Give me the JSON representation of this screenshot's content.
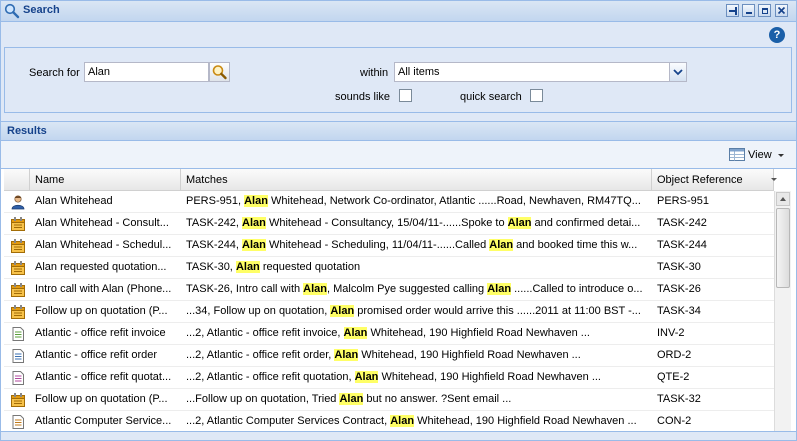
{
  "window": {
    "title": "Search"
  },
  "form": {
    "search_for_label": "Search for",
    "search_value": "Alan",
    "within_label": "within",
    "within_value": "All items",
    "sounds_like_label": "sounds like",
    "quick_search_label": "quick search"
  },
  "results": {
    "title": "Results",
    "view_label": "View",
    "columns": [
      "Name",
      "Matches",
      "Object Reference"
    ],
    "rows": [
      {
        "icon": "person-icon",
        "name": "Alan Whitehead",
        "matches": [
          [
            "PERS-951, ",
            0
          ],
          [
            "Alan",
            1
          ],
          [
            " Whitehead, Network Co-ordinator, Atlantic ......Road, Newhaven, RM47TQ...",
            0
          ]
        ],
        "ref": "PERS-951"
      },
      {
        "icon": "task-icon",
        "name": "Alan Whitehead - Consult...",
        "matches": [
          [
            "TASK-242, ",
            0
          ],
          [
            "Alan",
            1
          ],
          [
            " Whitehead - Consultancy, 15/04/11-......Spoke to ",
            0
          ],
          [
            "Alan",
            1
          ],
          [
            " and confirmed detai...",
            0
          ]
        ],
        "ref": "TASK-242"
      },
      {
        "icon": "task-icon",
        "name": "Alan Whitehead - Schedul...",
        "matches": [
          [
            "TASK-244, ",
            0
          ],
          [
            "Alan",
            1
          ],
          [
            " Whitehead - Scheduling, 11/04/11-......Called ",
            0
          ],
          [
            "Alan",
            1
          ],
          [
            " and booked time this w...",
            0
          ]
        ],
        "ref": "TASK-244"
      },
      {
        "icon": "task-icon",
        "name": "Alan requested quotation...",
        "matches": [
          [
            "TASK-30, ",
            0
          ],
          [
            "Alan",
            1
          ],
          [
            " requested quotation",
            0
          ]
        ],
        "ref": "TASK-30"
      },
      {
        "icon": "task-icon",
        "name": "Intro call with Alan (Phone...",
        "matches": [
          [
            "TASK-26, Intro call with ",
            0
          ],
          [
            "Alan",
            1
          ],
          [
            ", Malcolm Pye suggested calling ",
            0
          ],
          [
            "Alan",
            1
          ],
          [
            " ......Called to introduce o...",
            0
          ]
        ],
        "ref": "TASK-26"
      },
      {
        "icon": "task-icon",
        "name": "Follow up on quotation (P...",
        "matches": [
          [
            "...34, Follow up on quotation, ",
            0
          ],
          [
            "Alan",
            1
          ],
          [
            " promised order would arrive this ......2011 at 11:00 BST -...",
            0
          ]
        ],
        "ref": "TASK-34"
      },
      {
        "icon": "invoice-icon",
        "name": "Atlantic - office refit invoice",
        "matches": [
          [
            "...2, Atlantic - office refit invoice, ",
            0
          ],
          [
            "Alan",
            1
          ],
          [
            " Whitehead, 190 Highfield Road Newhaven ...",
            0
          ]
        ],
        "ref": "INV-2"
      },
      {
        "icon": "order-icon",
        "name": "Atlantic - office refit order",
        "matches": [
          [
            "...2, Atlantic - office refit order, ",
            0
          ],
          [
            "Alan",
            1
          ],
          [
            " Whitehead, 190 Highfield Road Newhaven ...",
            0
          ]
        ],
        "ref": "ORD-2"
      },
      {
        "icon": "quote-icon",
        "name": "Atlantic - office refit quotat...",
        "matches": [
          [
            "...2, Atlantic - office refit quotation, ",
            0
          ],
          [
            "Alan",
            1
          ],
          [
            " Whitehead, 190 Highfield Road Newhaven ...",
            0
          ]
        ],
        "ref": "QTE-2"
      },
      {
        "icon": "task-icon",
        "name": "Follow up on quotation (P...",
        "matches": [
          [
            "...Follow up on quotation, Tried ",
            0
          ],
          [
            "Alan",
            1
          ],
          [
            " but no answer. ?Sent email ...",
            0
          ]
        ],
        "ref": "TASK-32"
      },
      {
        "icon": "contract-icon",
        "name": "Atlantic Computer Service...",
        "matches": [
          [
            "...2, Atlantic Computer Services Contract, ",
            0
          ],
          [
            "Alan",
            1
          ],
          [
            " Whitehead, 190 Highfield Road Newhaven ...",
            0
          ]
        ],
        "ref": "CON-2"
      }
    ]
  }
}
